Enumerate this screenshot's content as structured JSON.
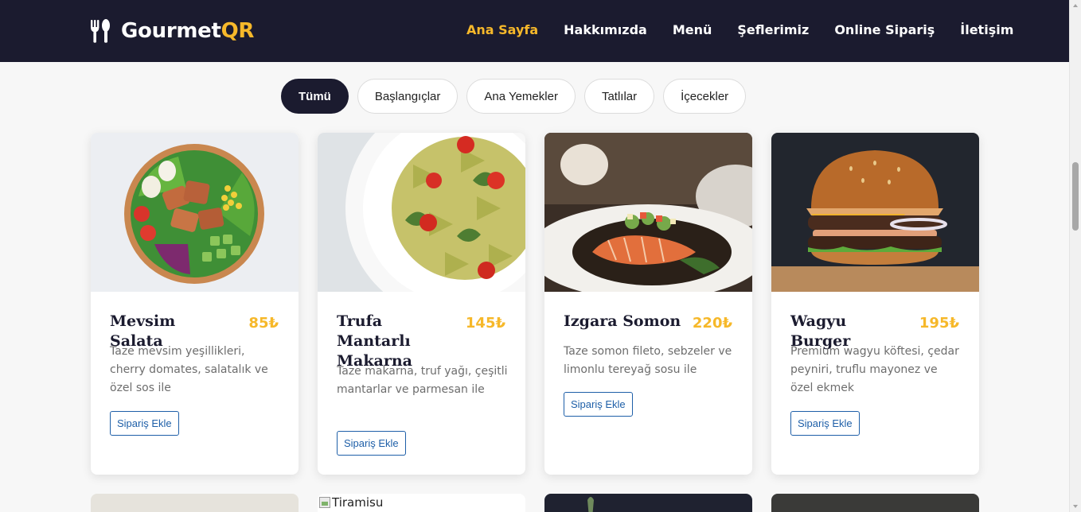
{
  "brand": {
    "name_main": "Gourmet",
    "name_accent": "QR",
    "icon": "fork-spoon-icon"
  },
  "nav": {
    "items": [
      "Ana Sayfa",
      "Hakkımızda",
      "Menü",
      "Şeflerimiz",
      "Online Sipariş",
      "İletişim"
    ],
    "active": "Ana Sayfa"
  },
  "filters": {
    "items": [
      "Tümü",
      "Başlangıçlar",
      "Ana Yemekler",
      "Tatlılar",
      "İçecekler"
    ],
    "active": "Tümü"
  },
  "menu_items": [
    {
      "name": "Mevsim Salata",
      "price": "85₺",
      "description": "Taze mevsim yeşillikleri, cherry domates, salatalık ve özel sos ile",
      "button": "Sipariş Ekle"
    },
    {
      "name": "Trufa Mantarlı Makarna",
      "price": "145₺",
      "description": "Taze makarna, truf yağı, çeşitli mantarlar ve parmesan ile",
      "button": "Sipariş Ekle"
    },
    {
      "name": "Izgara Somon",
      "price": "220₺",
      "description": "Taze somon fileto, sebzeler ve limonlu tereyağ sosu ile",
      "button": "Sipariş Ekle"
    },
    {
      "name": "Wagyu Burger",
      "price": "195₺",
      "description": "Premium wagyu köftesi, çedar peyniri, truflu mayonez ve özel ekmek",
      "button": "Sipariş Ekle"
    }
  ],
  "second_row": {
    "broken_image_alt": "Tiramisu"
  },
  "colors": {
    "header_bg": "#1b1b2f",
    "accent": "#f6b82a",
    "link_blue": "#1e5fa8"
  }
}
